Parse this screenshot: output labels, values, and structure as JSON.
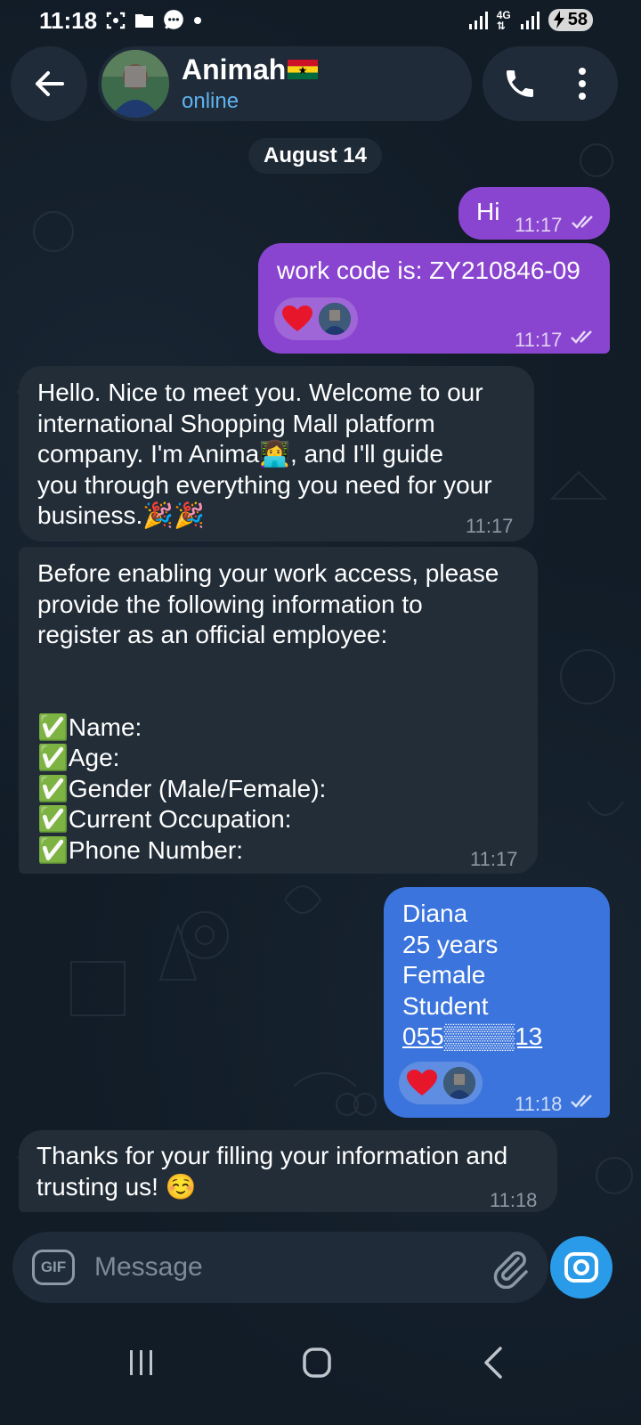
{
  "status_bar": {
    "time": "11:18",
    "network": "4G",
    "battery": "58"
  },
  "header": {
    "contact_name": "Animah",
    "status": "online"
  },
  "date_chip": "August 14",
  "messages": [
    {
      "type": "outgoing",
      "text": "Hi",
      "time": "11:17"
    },
    {
      "type": "outgoing",
      "text": "work code is: ZY210846-09",
      "time": "11:17",
      "reaction": "heart"
    },
    {
      "type": "incoming",
      "text": "Hello. Nice to meet you. Welcome to our\ninternational Shopping Mall platform\ncompany. I'm  Anima👩‍💻, and I'll guide\nyou through everything you need for your\nbusiness.🎉🎉",
      "time": "11:17"
    },
    {
      "type": "incoming",
      "text": "Before enabling your work access, please\nprovide the following information to\nregister as an official employee:\n\n\n✅Name:\n✅Age:\n✅Gender (Male/Female):\n✅Current Occupation:\n✅Phone Number:",
      "time": "11:17"
    },
    {
      "type": "outgoing",
      "lines": [
        "Diana",
        "25 years",
        "Female",
        "Student"
      ],
      "phone": "055▒▒▒▒13",
      "time": "11:18",
      "reaction": "heart"
    },
    {
      "type": "incoming",
      "text": "Thanks for your filling your information and\ntrusting us! ☺️",
      "time": "11:18"
    }
  ],
  "input": {
    "placeholder": "Message",
    "gif_label": "GIF"
  },
  "colors": {
    "outgoing_purple": "#8a45d0",
    "outgoing_blue": "#3b74dc",
    "incoming": "#222d38",
    "accent": "#2a9be8",
    "status_online": "#5fb3f0"
  },
  "icons": [
    "back-arrow-icon",
    "phone-icon",
    "more-vert-icon",
    "gif-icon",
    "paperclip-icon",
    "camera-icon",
    "recents-icon",
    "home-icon",
    "nav-back-icon"
  ]
}
